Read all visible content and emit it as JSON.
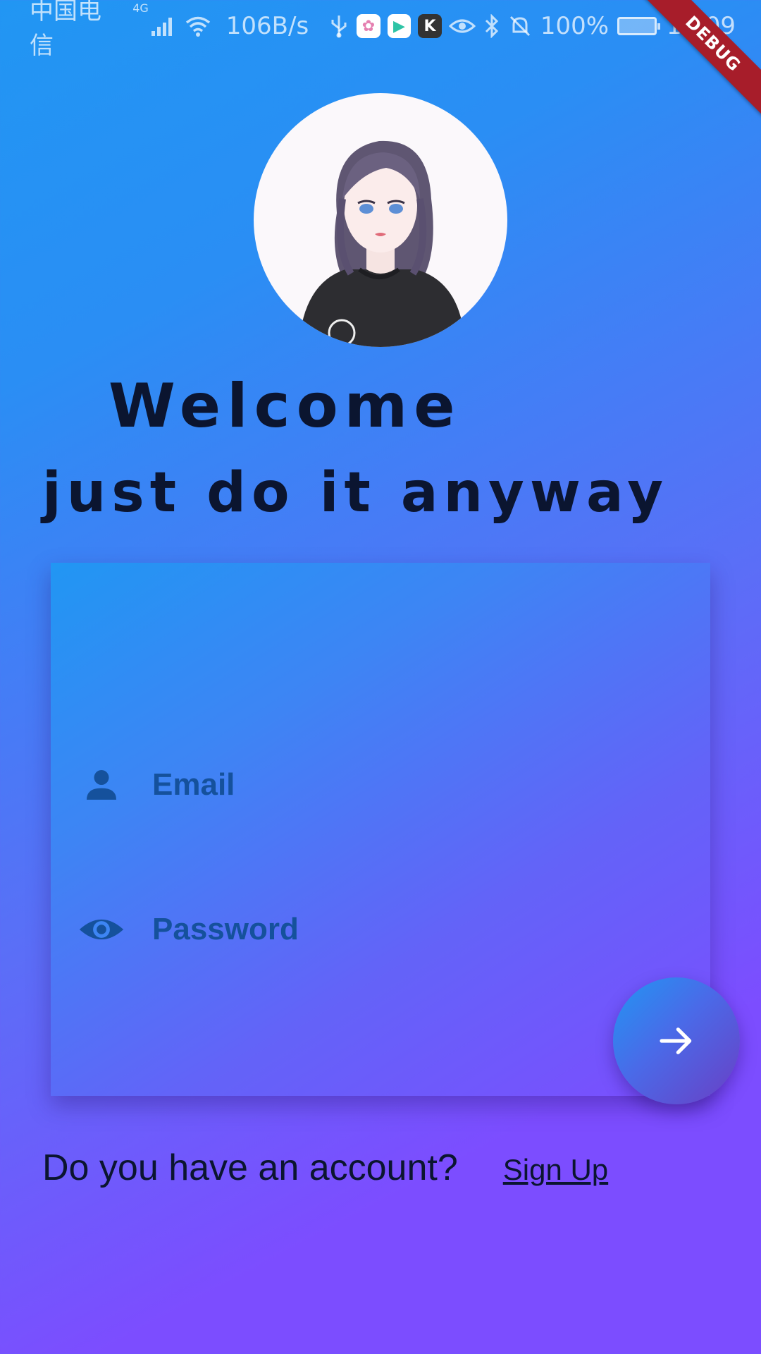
{
  "status_bar": {
    "carrier": "中国电信",
    "network_type": "4G",
    "speed": "106B/s",
    "battery": "100%",
    "time": "15:09"
  },
  "debug_banner": "DEBUG",
  "header": {
    "title": "Welcome",
    "subtitle": "just do it anyway"
  },
  "form": {
    "email_placeholder": "Email",
    "password_placeholder": "Password",
    "email_icon": "person-icon",
    "password_icon": "eye-icon",
    "submit_icon": "arrow-forward-icon"
  },
  "footer": {
    "prompt": "Do you have an account?",
    "signup_label": "Sign Up"
  },
  "colors": {
    "gradient_start": "#2196f3",
    "gradient_end": "#7c4dff",
    "field_text": "#15519c",
    "headline": "#0b1530",
    "debug_ribbon": "#a71d2a"
  }
}
